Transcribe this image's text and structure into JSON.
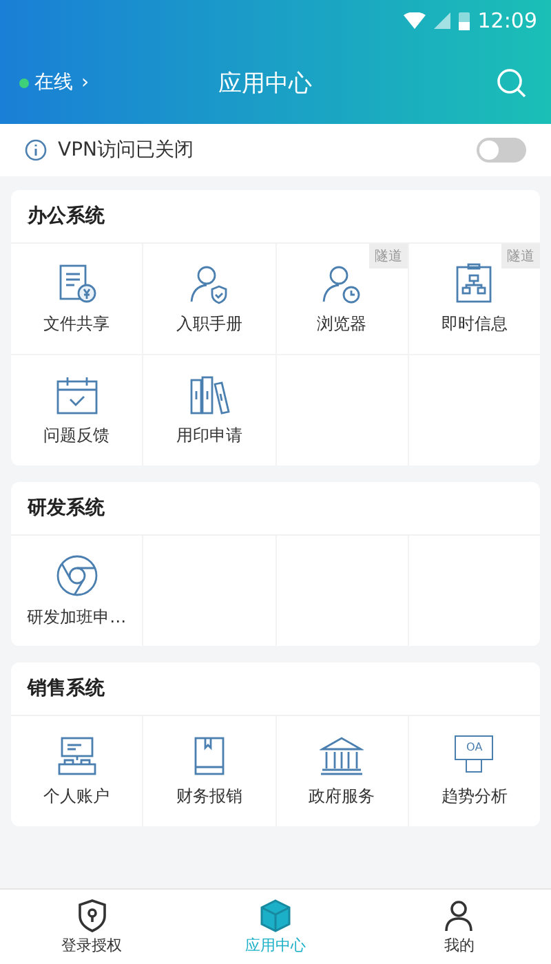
{
  "status_bar": {
    "time": "12:09"
  },
  "header": {
    "status": "在线",
    "chevron": "›",
    "title": "应用中心"
  },
  "vpn": {
    "label": "VPN访问已关闭",
    "on": false
  },
  "sections": [
    {
      "title": "办公系统",
      "items": [
        {
          "label": "文件共享",
          "kind": "doc"
        },
        {
          "label": "入职手册",
          "kind": "usershield"
        },
        {
          "label": "浏览器",
          "kind": "userclock",
          "badge": "隧道"
        },
        {
          "label": "即时信息",
          "kind": "org",
          "badge": "隧道"
        },
        {
          "label": "问题反馈",
          "kind": "calendar"
        },
        {
          "label": "用印申请",
          "kind": "books"
        }
      ]
    },
    {
      "title": "研发系统",
      "items": [
        {
          "label": "研发加班申…",
          "kind": "browser"
        }
      ]
    },
    {
      "title": "销售系统",
      "items": [
        {
          "label": "个人账户",
          "kind": "desk"
        },
        {
          "label": "财务报销",
          "kind": "book"
        },
        {
          "label": "政府服务",
          "kind": "bank"
        },
        {
          "label": "趋势分析",
          "kind": "monitor",
          "monitor_text": "OA"
        }
      ]
    }
  ],
  "tabs": [
    {
      "label": "登录授权",
      "kind": "shield",
      "selected": false
    },
    {
      "label": "应用中心",
      "kind": "cube",
      "selected": true
    },
    {
      "label": "我的",
      "kind": "person",
      "selected": false
    }
  ]
}
